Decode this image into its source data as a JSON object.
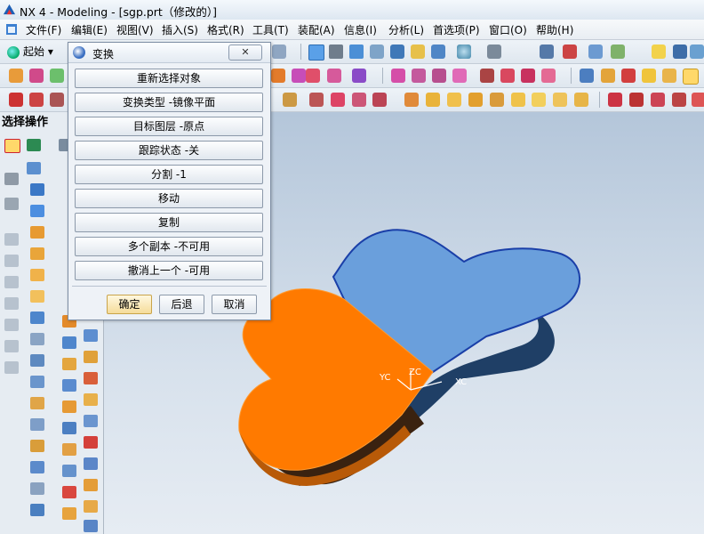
{
  "window": {
    "title": "NX 4 - Modeling - [sgp.prt（修改的）]"
  },
  "menu": [
    "文件(F)",
    "编辑(E)",
    "视图(V)",
    "插入(S)",
    "格式(R)",
    "工具(T)",
    "装配(A)",
    "信息(I)",
    "分析(L)",
    "首选项(P)",
    "窗口(O)",
    "帮助(H)"
  ],
  "toolbar": {
    "start_label": "起始"
  },
  "left_panel": {
    "title": "选择操作"
  },
  "dialog": {
    "title": "变换",
    "buttons": [
      "重新选择对象",
      "变换类型 -镜像平面",
      "目标图层 -原点",
      "跟踪状态 -关",
      "分割 -1",
      "移动",
      "复制",
      "多个副本 -不可用",
      "撤消上一个 -可用"
    ],
    "ok": "确定",
    "back": "后退",
    "cancel": "取消"
  },
  "viewport": {
    "axes": {
      "xc": "XC",
      "yc": "YC",
      "zc": "ZC"
    },
    "colors": {
      "selected_half": "#ff7a00",
      "other_half": "#6a9fdc",
      "base_dark": "#1f3f66"
    }
  }
}
